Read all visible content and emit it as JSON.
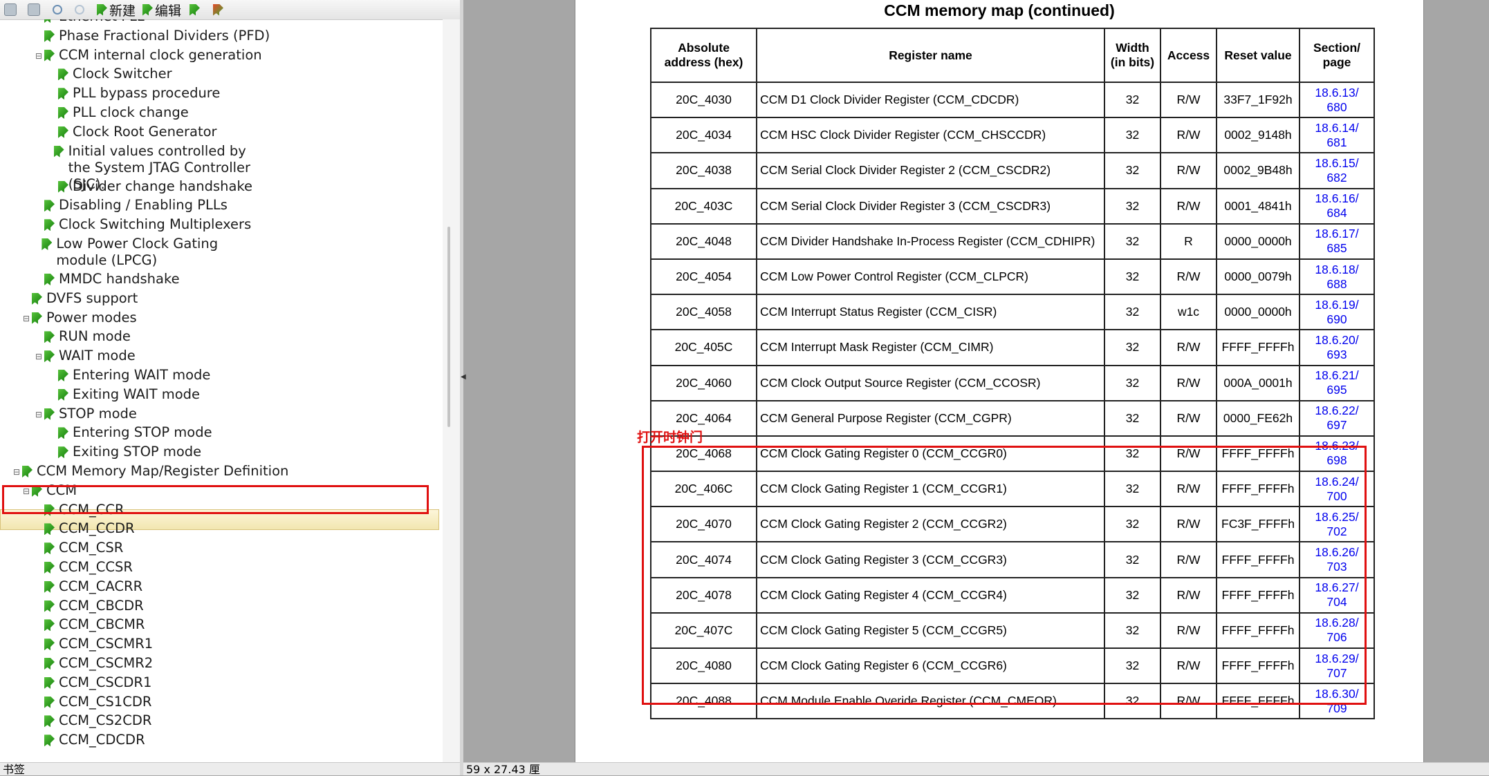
{
  "toolbar": {
    "new_label": "新建",
    "edit_label": "编辑"
  },
  "bookmarks": [
    {
      "label": "Ethernet PLL",
      "level": 3,
      "expander": ""
    },
    {
      "label": "Phase Fractional Dividers (PFD)",
      "level": 3,
      "expander": ""
    },
    {
      "label": "CCM internal clock generation",
      "level": 3,
      "expander": "⊟"
    },
    {
      "label": "Clock Switcher",
      "level": 4,
      "expander": ""
    },
    {
      "label": "PLL bypass procedure",
      "level": 4,
      "expander": ""
    },
    {
      "label": "PLL clock change",
      "level": 4,
      "expander": ""
    },
    {
      "label": "Clock Root Generator",
      "level": 4,
      "expander": ""
    },
    {
      "label": "Initial values controlled by the System JTAG Controller (SJC).",
      "level": 4,
      "expander": "",
      "multi": true
    },
    {
      "label": "Divider change handshake",
      "level": 4,
      "expander": ""
    },
    {
      "label": "Disabling / Enabling PLLs",
      "level": 3,
      "expander": ""
    },
    {
      "label": "Clock Switching Multiplexers",
      "level": 3,
      "expander": ""
    },
    {
      "label": "Low Power Clock Gating module (LPCG)",
      "level": 3,
      "expander": "",
      "multi": true
    },
    {
      "label": "MMDC handshake",
      "level": 3,
      "expander": ""
    },
    {
      "label": "DVFS support",
      "level": 2,
      "expander": ""
    },
    {
      "label": "Power modes",
      "level": 2,
      "expander": "⊟"
    },
    {
      "label": "RUN mode",
      "level": 3,
      "expander": ""
    },
    {
      "label": "WAIT mode",
      "level": 3,
      "expander": "⊟"
    },
    {
      "label": "Entering WAIT mode",
      "level": 4,
      "expander": ""
    },
    {
      "label": "Exiting WAIT mode",
      "level": 4,
      "expander": ""
    },
    {
      "label": "STOP mode",
      "level": 3,
      "expander": "⊟"
    },
    {
      "label": "Entering STOP mode",
      "level": 4,
      "expander": ""
    },
    {
      "label": "Exiting STOP mode",
      "level": 4,
      "expander": ""
    },
    {
      "label": "CCM Memory Map/Register Definition",
      "level": 1,
      "expander": "⊟"
    },
    {
      "label": "CCM",
      "level": 2,
      "expander": "⊟",
      "selected": true
    },
    {
      "label": "CCM_CCR",
      "level": 3,
      "expander": ""
    },
    {
      "label": "CCM_CCDR",
      "level": 3,
      "expander": ""
    },
    {
      "label": "CCM_CSR",
      "level": 3,
      "expander": ""
    },
    {
      "label": "CCM_CCSR",
      "level": 3,
      "expander": ""
    },
    {
      "label": "CCM_CACRR",
      "level": 3,
      "expander": ""
    },
    {
      "label": "CCM_CBCDR",
      "level": 3,
      "expander": ""
    },
    {
      "label": "CCM_CBCMR",
      "level": 3,
      "expander": ""
    },
    {
      "label": "CCM_CSCMR1",
      "level": 3,
      "expander": ""
    },
    {
      "label": "CCM_CSCMR2",
      "level": 3,
      "expander": ""
    },
    {
      "label": "CCM_CSCDR1",
      "level": 3,
      "expander": ""
    },
    {
      "label": "CCM_CS1CDR",
      "level": 3,
      "expander": ""
    },
    {
      "label": "CCM_CS2CDR",
      "level": 3,
      "expander": ""
    },
    {
      "label": "CCM_CDCDR",
      "level": 3,
      "expander": ""
    }
  ],
  "status": {
    "left": "书签",
    "right": "59 x 27.43 厘"
  },
  "document": {
    "title": "CCM memory map (continued)",
    "headers": {
      "address": "Absolute address (hex)",
      "name": "Register name",
      "width": "Width (in bits)",
      "access": "Access",
      "reset": "Reset value",
      "section": "Section/ page"
    },
    "rows": [
      {
        "address": "20C_4030",
        "name": "CCM D1 Clock Divider Register (CCM_CDCDR)",
        "width": "32",
        "access": "R/W",
        "reset": "33F7_1F92h",
        "section": "18.6.13/",
        "page": "680"
      },
      {
        "address": "20C_4034",
        "name": "CCM HSC Clock Divider Register (CCM_CHSCCDR)",
        "width": "32",
        "access": "R/W",
        "reset": "0002_9148h",
        "section": "18.6.14/",
        "page": "681"
      },
      {
        "address": "20C_4038",
        "name": "CCM Serial Clock Divider Register 2 (CCM_CSCDR2)",
        "width": "32",
        "access": "R/W",
        "reset": "0002_9B48h",
        "section": "18.6.15/",
        "page": "682"
      },
      {
        "address": "20C_403C",
        "name": "CCM Serial Clock Divider Register 3 (CCM_CSCDR3)",
        "width": "32",
        "access": "R/W",
        "reset": "0001_4841h",
        "section": "18.6.16/",
        "page": "684"
      },
      {
        "address": "20C_4048",
        "name": "CCM Divider Handshake In-Process Register (CCM_CDHIPR)",
        "width": "32",
        "access": "R",
        "reset": "0000_0000h",
        "section": "18.6.17/",
        "page": "685"
      },
      {
        "address": "20C_4054",
        "name": "CCM Low Power Control Register (CCM_CLPCR)",
        "width": "32",
        "access": "R/W",
        "reset": "0000_0079h",
        "section": "18.6.18/",
        "page": "688"
      },
      {
        "address": "20C_4058",
        "name": "CCM Interrupt Status Register (CCM_CISR)",
        "width": "32",
        "access": "w1c",
        "reset": "0000_0000h",
        "section": "18.6.19/",
        "page": "690"
      },
      {
        "address": "20C_405C",
        "name": "CCM Interrupt Mask Register (CCM_CIMR)",
        "width": "32",
        "access": "R/W",
        "reset": "FFFF_FFFFh",
        "section": "18.6.20/",
        "page": "693"
      },
      {
        "address": "20C_4060",
        "name": "CCM Clock Output Source Register (CCM_CCOSR)",
        "width": "32",
        "access": "R/W",
        "reset": "000A_0001h",
        "section": "18.6.21/",
        "page": "695"
      },
      {
        "address": "20C_4064",
        "name": "CCM General Purpose Register (CCM_CGPR)",
        "width": "32",
        "access": "R/W",
        "reset": "0000_FE62h",
        "section": "18.6.22/",
        "page": "697"
      },
      {
        "address": "20C_4068",
        "name": "CCM Clock Gating Register 0 (CCM_CCGR0)",
        "width": "32",
        "access": "R/W",
        "reset": "FFFF_FFFFh",
        "section": "18.6.23/",
        "page": "698"
      },
      {
        "address": "20C_406C",
        "name": "CCM Clock Gating Register 1 (CCM_CCGR1)",
        "width": "32",
        "access": "R/W",
        "reset": "FFFF_FFFFh",
        "section": "18.6.24/",
        "page": "700"
      },
      {
        "address": "20C_4070",
        "name": "CCM Clock Gating Register 2 (CCM_CCGR2)",
        "width": "32",
        "access": "R/W",
        "reset": "FC3F_FFFFh",
        "section": "18.6.25/",
        "page": "702"
      },
      {
        "address": "20C_4074",
        "name": "CCM Clock Gating Register 3 (CCM_CCGR3)",
        "width": "32",
        "access": "R/W",
        "reset": "FFFF_FFFFh",
        "section": "18.6.26/",
        "page": "703"
      },
      {
        "address": "20C_4078",
        "name": "CCM Clock Gating Register 4 (CCM_CCGR4)",
        "width": "32",
        "access": "R/W",
        "reset": "FFFF_FFFFh",
        "section": "18.6.27/",
        "page": "704"
      },
      {
        "address": "20C_407C",
        "name": "CCM Clock Gating Register 5 (CCM_CCGR5)",
        "width": "32",
        "access": "R/W",
        "reset": "FFFF_FFFFh",
        "section": "18.6.28/",
        "page": "706"
      },
      {
        "address": "20C_4080",
        "name": "CCM Clock Gating Register 6 (CCM_CCGR6)",
        "width": "32",
        "access": "R/W",
        "reset": "FFFF_FFFFh",
        "section": "18.6.29/",
        "page": "707"
      },
      {
        "address": "20C_4088",
        "name": "CCM Module Enable Overide Register (CCM_CMEOR)",
        "width": "32",
        "access": "R/W",
        "reset": "FFFF_FFFFh",
        "section": "18.6.30/",
        "page": "709"
      }
    ]
  },
  "annotation": {
    "label": "打开时钟门",
    "color": "#e01010"
  }
}
